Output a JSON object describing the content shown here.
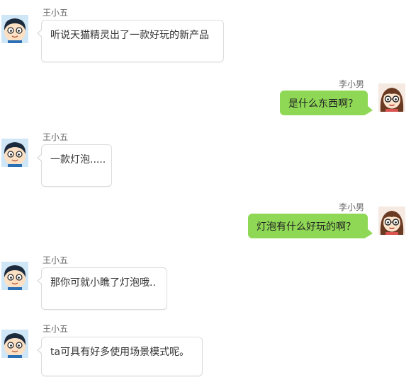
{
  "colors": {
    "right_bubble": "#8fd856",
    "left_bubble_border": "#dcdcdc",
    "name_text": "#666666"
  },
  "messages": [
    {
      "sender": "王小五",
      "side": "left",
      "avatar": "boy-avatar-icon",
      "text": "听说天猫精灵出了一款好玩的新产品"
    },
    {
      "sender": "李小男",
      "side": "right",
      "avatar": "girl-avatar-icon",
      "text": "是什么东西啊？"
    },
    {
      "sender": "王小五",
      "side": "left",
      "avatar": "boy-avatar-icon",
      "text": "一款灯泡....."
    },
    {
      "sender": "李小男",
      "side": "right",
      "avatar": "girl-avatar-icon",
      "text": "灯泡有什么好玩的啊？"
    },
    {
      "sender": "王小五",
      "side": "left",
      "avatar": "boy-avatar-icon",
      "text": "那你可就小瞧了灯泡哦.."
    },
    {
      "sender": "王小五",
      "side": "left",
      "avatar": "boy-avatar-icon",
      "text": "ta可具有好多使用场景模式呢。"
    }
  ]
}
